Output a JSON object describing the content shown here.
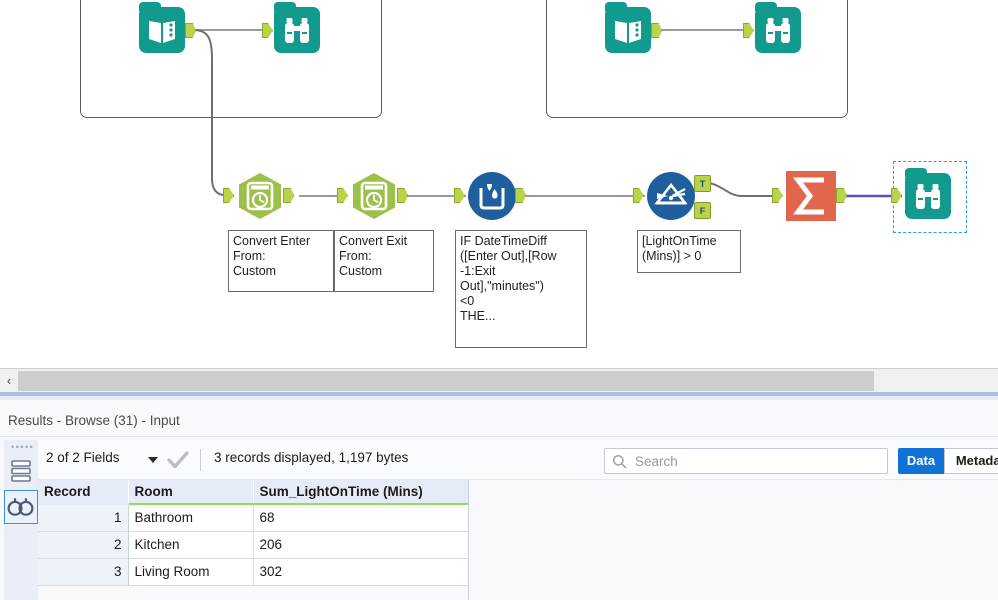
{
  "canvas": {
    "containers": [
      {
        "name": "container-left"
      },
      {
        "name": "container-right"
      }
    ],
    "tools": [
      {
        "id": "input-1",
        "type": "input-data",
        "icon": "book-icon",
        "label": "Input Data"
      },
      {
        "id": "browse-1",
        "type": "browse",
        "icon": "binoculars-icon",
        "label": "Browse"
      },
      {
        "id": "input-2",
        "type": "input-data",
        "icon": "book-icon",
        "label": "Input Data"
      },
      {
        "id": "browse-2",
        "type": "browse",
        "icon": "binoculars-icon",
        "label": "Browse"
      },
      {
        "id": "datetime-1",
        "type": "datetime",
        "icon": "clock-icon",
        "label": "DateTime"
      },
      {
        "id": "datetime-2",
        "type": "datetime",
        "icon": "clock-icon",
        "label": "DateTime"
      },
      {
        "id": "formula-1",
        "type": "formula",
        "icon": "beaker-drop-icon",
        "label": "Formula"
      },
      {
        "id": "filter-1",
        "type": "filter",
        "icon": "funnel-icon",
        "label": "Filter"
      },
      {
        "id": "summarize-1",
        "type": "summarize",
        "icon": "sigma-icon",
        "label": "Summarize"
      },
      {
        "id": "browse-3",
        "type": "browse",
        "icon": "binoculars-icon",
        "label": "Browse",
        "selected": true
      }
    ],
    "annotations": {
      "convert_enter": "Convert Enter\nFrom:\nCustom",
      "convert_exit": "Convert Exit\nFrom:\nCustom",
      "formula": "IF DateTimeDiff\n([Enter Out],[Row\n-1:Exit\nOut],\"minutes\")\n<0\nTHE...",
      "filter": "[LightOnTime\n(Mins)] > 0"
    },
    "filter_anchors": {
      "true": "T",
      "false": "F"
    }
  },
  "results": {
    "title": "Results - Browse (31) - Input",
    "toolbar": {
      "fields_label": "2 of 2 Fields",
      "records_label": "3 records displayed, 1,197 bytes",
      "search_placeholder": "Search",
      "search_value": "",
      "data_tab": "Data",
      "metadata_tab": "Metadata",
      "active_tab": "Data"
    },
    "rail": {
      "layout_icon": "rows-layout-icon",
      "browse_icon": "binoculars-icon",
      "selected": "browse"
    },
    "table": {
      "columns": [
        "Record",
        "Room",
        "Sum_LightOnTime (Mins)"
      ],
      "rows": [
        {
          "record": "1",
          "room": "Bathroom",
          "sum": "68"
        },
        {
          "record": "2",
          "room": "Kitchen",
          "sum": "206"
        },
        {
          "record": "3",
          "room": "Living Room",
          "sum": "302"
        }
      ]
    }
  },
  "scrollbar": {
    "left_chevron": "‹"
  },
  "colors": {
    "teal": "#119a8d",
    "green_hex": "#9dc04a",
    "blue_circle": "#1f5f9e",
    "summarize": "#e0674c",
    "accent_blue": "#0f72d4",
    "anchor_green": "#b8d44a",
    "header_green_rule": "#8ede5c"
  }
}
